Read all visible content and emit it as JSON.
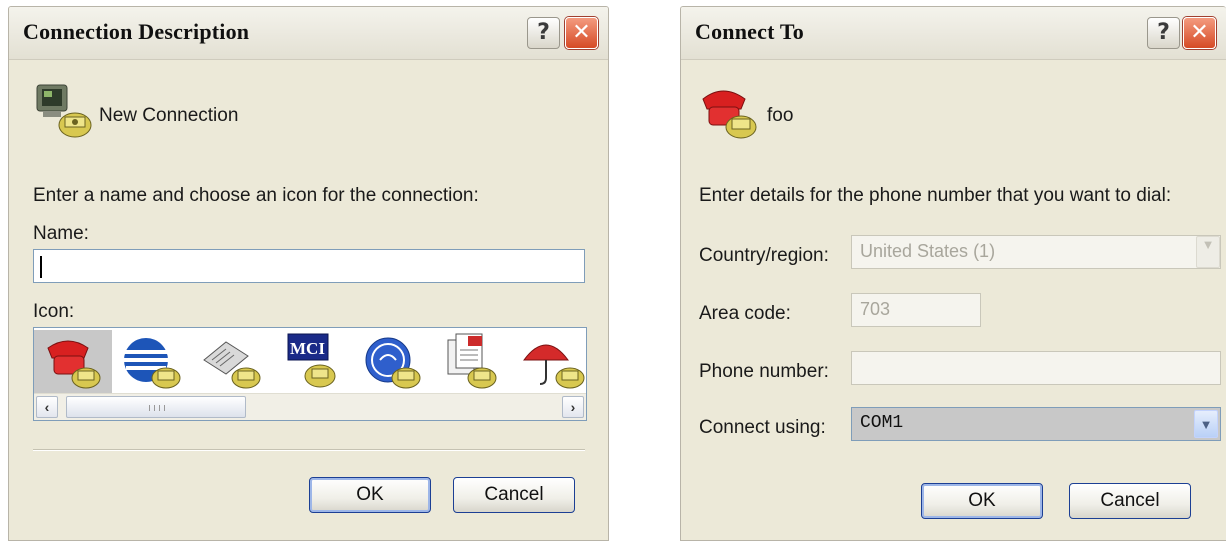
{
  "dialog1": {
    "title": "Connection Description",
    "connection_name": "New Connection",
    "instruction": "Enter a name and choose an icon for the connection:",
    "name_label": "Name:",
    "name_value": "",
    "icon_label": "Icon:",
    "icons": [
      "red-phone-icon",
      "globe-phone-icon",
      "news-phone-icon",
      "mci-phone-icon",
      "ge-phone-icon",
      "documents-phone-icon",
      "umbrella-phone-icon"
    ],
    "mci_text": "MCI",
    "ok_label": "OK",
    "cancel_label": "Cancel"
  },
  "dialog2": {
    "title": "Connect To",
    "connection_name": "foo",
    "instruction": "Enter details for the phone number that you want to dial:",
    "country_label": "Country/region:",
    "country_value": "United States (1)",
    "area_label": "Area code:",
    "area_value": "703",
    "phone_label": "Phone number:",
    "phone_value": "",
    "connect_label": "Connect using:",
    "connect_value": "COM1",
    "ok_label": "OK",
    "cancel_label": "Cancel"
  },
  "colors": {
    "dialog_bg": "#ece9d8",
    "close_button": "#d64a25",
    "input_border": "#7f9db9",
    "selection_bg": "#c8c8c8"
  }
}
